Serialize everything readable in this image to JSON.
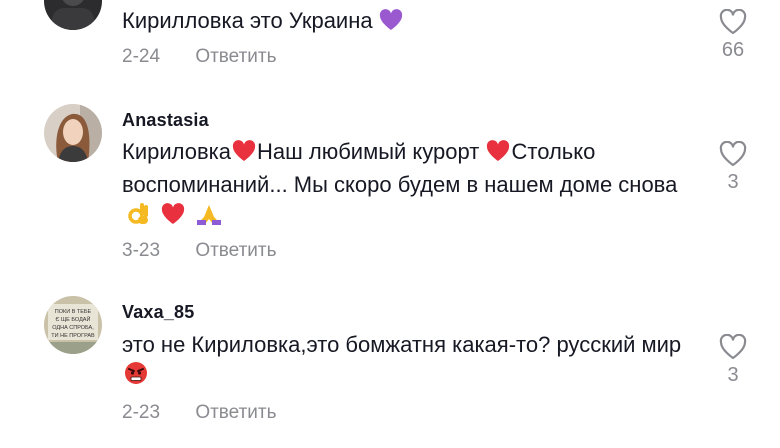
{
  "comments": [
    {
      "username": "",
      "text": "Кирилловка это Украина",
      "emoji": [
        "purple-heart"
      ],
      "date": "2-24",
      "reply_label": "Ответить",
      "likes": "66"
    },
    {
      "username": "Anastasia",
      "text_parts": [
        "Кириловка",
        "Наш любимый курорт",
        "Столько воспоминаний... Мы скоро будем в нашем доме снова"
      ],
      "emoji": [
        "red-heart",
        "red-heart",
        "ok-hand",
        "red-heart",
        "praying-hands"
      ],
      "date": "3-23",
      "reply_label": "Ответить",
      "likes": "3"
    },
    {
      "username": "Vaxa_85",
      "text": "это не Кириловка,это бомжатня какая-то? русский мир",
      "emoji": [
        "angry-face"
      ],
      "date": "2-23",
      "reply_label": "Ответить",
      "likes": "3",
      "avatar_text": [
        "ПОКИ В ТЕБЕ",
        "Є ЩЕ БОДАЙ",
        "ОДНА СПРОБА,",
        "ТИ НЕ ПРОГРАВ"
      ]
    }
  ],
  "colors": {
    "text": "#161823",
    "muted": "#8a8b91"
  }
}
